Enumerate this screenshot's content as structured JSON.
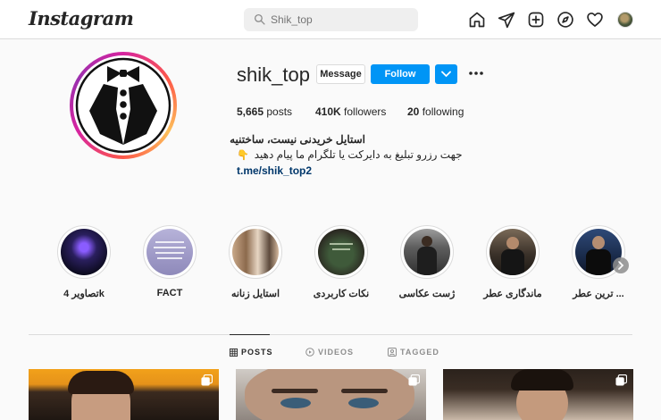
{
  "header": {
    "logo": "Instagram",
    "search_placeholder": "Shik_top",
    "nav_icons": [
      "home-icon",
      "direct-message-icon",
      "new-post-icon",
      "explore-icon",
      "activity-heart-icon",
      "profile-avatar"
    ]
  },
  "profile": {
    "username": "shik_top",
    "message_label": "Message",
    "follow_label": "Follow",
    "stats": {
      "posts_count": "5,665",
      "posts_label": "posts",
      "followers_count": "410K",
      "followers_label": "followers",
      "following_count": "20",
      "following_label": "following"
    },
    "bio_name": "استایل خریدنی نیست، ساختنیه",
    "bio_line": "جهت رزرو تبلیغ به دایرکت یا تلگرام ما پیام دهید",
    "bio_emoji": "👇",
    "bio_link": "t.me/shik_top2"
  },
  "highlights": [
    {
      "label": "تصاویر 4k"
    },
    {
      "label": "FACT"
    },
    {
      "label": "استایل زنانه"
    },
    {
      "label": "نکات کاربردی"
    },
    {
      "label": "ژست عکاسی"
    },
    {
      "label": "ماندگاری عطر"
    },
    {
      "label": "ترین عطر ..."
    }
  ],
  "tabs": [
    {
      "label": "POSTS",
      "icon": "grid-icon",
      "active": true
    },
    {
      "label": "VIDEOS",
      "icon": "video-icon",
      "active": false
    },
    {
      "label": "TAGGED",
      "icon": "tagged-icon",
      "active": false
    }
  ],
  "posts": [
    {
      "icon": "multiple-photos-icon"
    },
    {
      "icon": "multiple-photos-icon"
    },
    {
      "icon": "multiple-photos-icon"
    }
  ],
  "colors": {
    "follow_button": "#0095f6",
    "link": "#00376b",
    "background": "#fafafa"
  }
}
